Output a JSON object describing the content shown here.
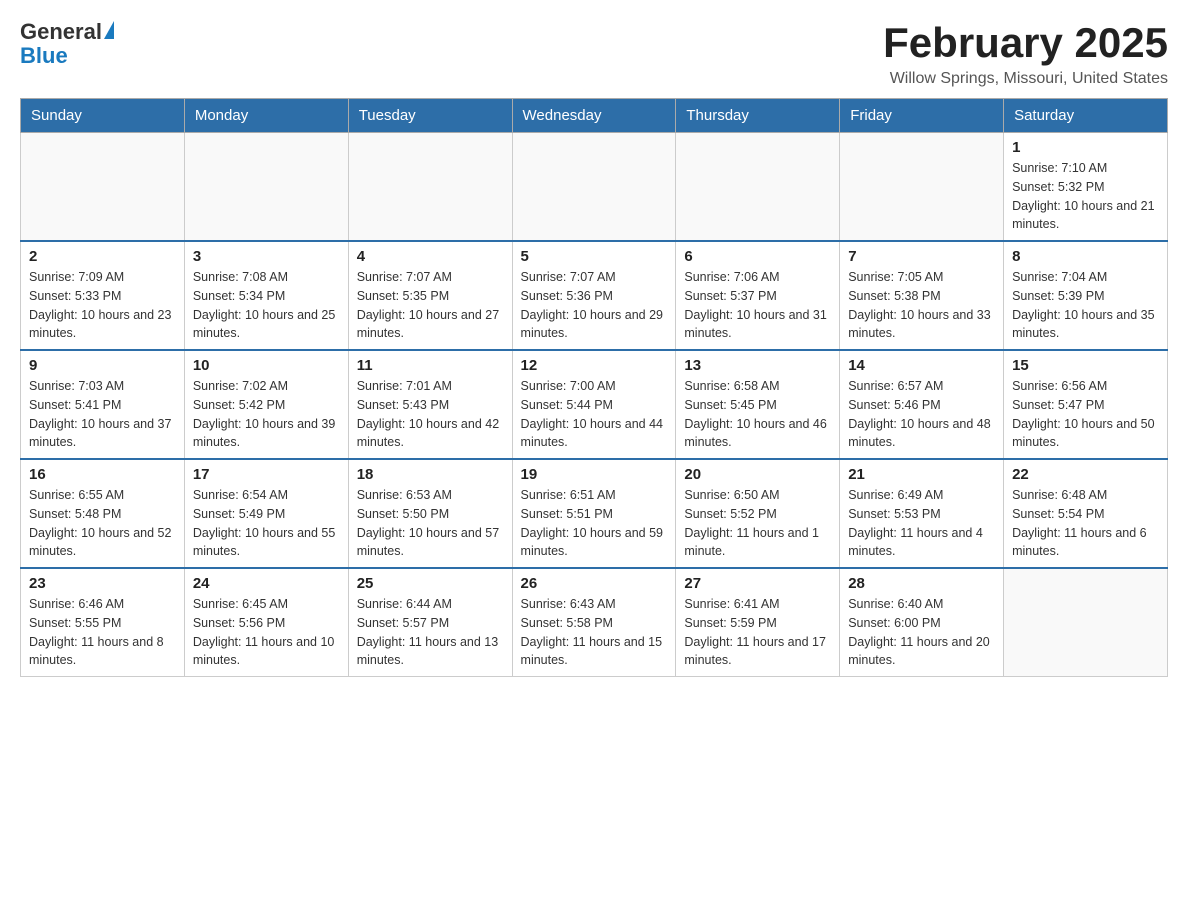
{
  "header": {
    "logo": {
      "general": "General",
      "blue": "Blue"
    },
    "title": "February 2025",
    "location": "Willow Springs, Missouri, United States"
  },
  "weekdays": [
    "Sunday",
    "Monday",
    "Tuesday",
    "Wednesday",
    "Thursday",
    "Friday",
    "Saturday"
  ],
  "weeks": [
    [
      {
        "day": "",
        "sunrise": "",
        "sunset": "",
        "daylight": ""
      },
      {
        "day": "",
        "sunrise": "",
        "sunset": "",
        "daylight": ""
      },
      {
        "day": "",
        "sunrise": "",
        "sunset": "",
        "daylight": ""
      },
      {
        "day": "",
        "sunrise": "",
        "sunset": "",
        "daylight": ""
      },
      {
        "day": "",
        "sunrise": "",
        "sunset": "",
        "daylight": ""
      },
      {
        "day": "",
        "sunrise": "",
        "sunset": "",
        "daylight": ""
      },
      {
        "day": "1",
        "sunrise": "Sunrise: 7:10 AM",
        "sunset": "Sunset: 5:32 PM",
        "daylight": "Daylight: 10 hours and 21 minutes."
      }
    ],
    [
      {
        "day": "2",
        "sunrise": "Sunrise: 7:09 AM",
        "sunset": "Sunset: 5:33 PM",
        "daylight": "Daylight: 10 hours and 23 minutes."
      },
      {
        "day": "3",
        "sunrise": "Sunrise: 7:08 AM",
        "sunset": "Sunset: 5:34 PM",
        "daylight": "Daylight: 10 hours and 25 minutes."
      },
      {
        "day": "4",
        "sunrise": "Sunrise: 7:07 AM",
        "sunset": "Sunset: 5:35 PM",
        "daylight": "Daylight: 10 hours and 27 minutes."
      },
      {
        "day": "5",
        "sunrise": "Sunrise: 7:07 AM",
        "sunset": "Sunset: 5:36 PM",
        "daylight": "Daylight: 10 hours and 29 minutes."
      },
      {
        "day": "6",
        "sunrise": "Sunrise: 7:06 AM",
        "sunset": "Sunset: 5:37 PM",
        "daylight": "Daylight: 10 hours and 31 minutes."
      },
      {
        "day": "7",
        "sunrise": "Sunrise: 7:05 AM",
        "sunset": "Sunset: 5:38 PM",
        "daylight": "Daylight: 10 hours and 33 minutes."
      },
      {
        "day": "8",
        "sunrise": "Sunrise: 7:04 AM",
        "sunset": "Sunset: 5:39 PM",
        "daylight": "Daylight: 10 hours and 35 minutes."
      }
    ],
    [
      {
        "day": "9",
        "sunrise": "Sunrise: 7:03 AM",
        "sunset": "Sunset: 5:41 PM",
        "daylight": "Daylight: 10 hours and 37 minutes."
      },
      {
        "day": "10",
        "sunrise": "Sunrise: 7:02 AM",
        "sunset": "Sunset: 5:42 PM",
        "daylight": "Daylight: 10 hours and 39 minutes."
      },
      {
        "day": "11",
        "sunrise": "Sunrise: 7:01 AM",
        "sunset": "Sunset: 5:43 PM",
        "daylight": "Daylight: 10 hours and 42 minutes."
      },
      {
        "day": "12",
        "sunrise": "Sunrise: 7:00 AM",
        "sunset": "Sunset: 5:44 PM",
        "daylight": "Daylight: 10 hours and 44 minutes."
      },
      {
        "day": "13",
        "sunrise": "Sunrise: 6:58 AM",
        "sunset": "Sunset: 5:45 PM",
        "daylight": "Daylight: 10 hours and 46 minutes."
      },
      {
        "day": "14",
        "sunrise": "Sunrise: 6:57 AM",
        "sunset": "Sunset: 5:46 PM",
        "daylight": "Daylight: 10 hours and 48 minutes."
      },
      {
        "day": "15",
        "sunrise": "Sunrise: 6:56 AM",
        "sunset": "Sunset: 5:47 PM",
        "daylight": "Daylight: 10 hours and 50 minutes."
      }
    ],
    [
      {
        "day": "16",
        "sunrise": "Sunrise: 6:55 AM",
        "sunset": "Sunset: 5:48 PM",
        "daylight": "Daylight: 10 hours and 52 minutes."
      },
      {
        "day": "17",
        "sunrise": "Sunrise: 6:54 AM",
        "sunset": "Sunset: 5:49 PM",
        "daylight": "Daylight: 10 hours and 55 minutes."
      },
      {
        "day": "18",
        "sunrise": "Sunrise: 6:53 AM",
        "sunset": "Sunset: 5:50 PM",
        "daylight": "Daylight: 10 hours and 57 minutes."
      },
      {
        "day": "19",
        "sunrise": "Sunrise: 6:51 AM",
        "sunset": "Sunset: 5:51 PM",
        "daylight": "Daylight: 10 hours and 59 minutes."
      },
      {
        "day": "20",
        "sunrise": "Sunrise: 6:50 AM",
        "sunset": "Sunset: 5:52 PM",
        "daylight": "Daylight: 11 hours and 1 minute."
      },
      {
        "day": "21",
        "sunrise": "Sunrise: 6:49 AM",
        "sunset": "Sunset: 5:53 PM",
        "daylight": "Daylight: 11 hours and 4 minutes."
      },
      {
        "day": "22",
        "sunrise": "Sunrise: 6:48 AM",
        "sunset": "Sunset: 5:54 PM",
        "daylight": "Daylight: 11 hours and 6 minutes."
      }
    ],
    [
      {
        "day": "23",
        "sunrise": "Sunrise: 6:46 AM",
        "sunset": "Sunset: 5:55 PM",
        "daylight": "Daylight: 11 hours and 8 minutes."
      },
      {
        "day": "24",
        "sunrise": "Sunrise: 6:45 AM",
        "sunset": "Sunset: 5:56 PM",
        "daylight": "Daylight: 11 hours and 10 minutes."
      },
      {
        "day": "25",
        "sunrise": "Sunrise: 6:44 AM",
        "sunset": "Sunset: 5:57 PM",
        "daylight": "Daylight: 11 hours and 13 minutes."
      },
      {
        "day": "26",
        "sunrise": "Sunrise: 6:43 AM",
        "sunset": "Sunset: 5:58 PM",
        "daylight": "Daylight: 11 hours and 15 minutes."
      },
      {
        "day": "27",
        "sunrise": "Sunrise: 6:41 AM",
        "sunset": "Sunset: 5:59 PM",
        "daylight": "Daylight: 11 hours and 17 minutes."
      },
      {
        "day": "28",
        "sunrise": "Sunrise: 6:40 AM",
        "sunset": "Sunset: 6:00 PM",
        "daylight": "Daylight: 11 hours and 20 minutes."
      },
      {
        "day": "",
        "sunrise": "",
        "sunset": "",
        "daylight": ""
      }
    ]
  ]
}
